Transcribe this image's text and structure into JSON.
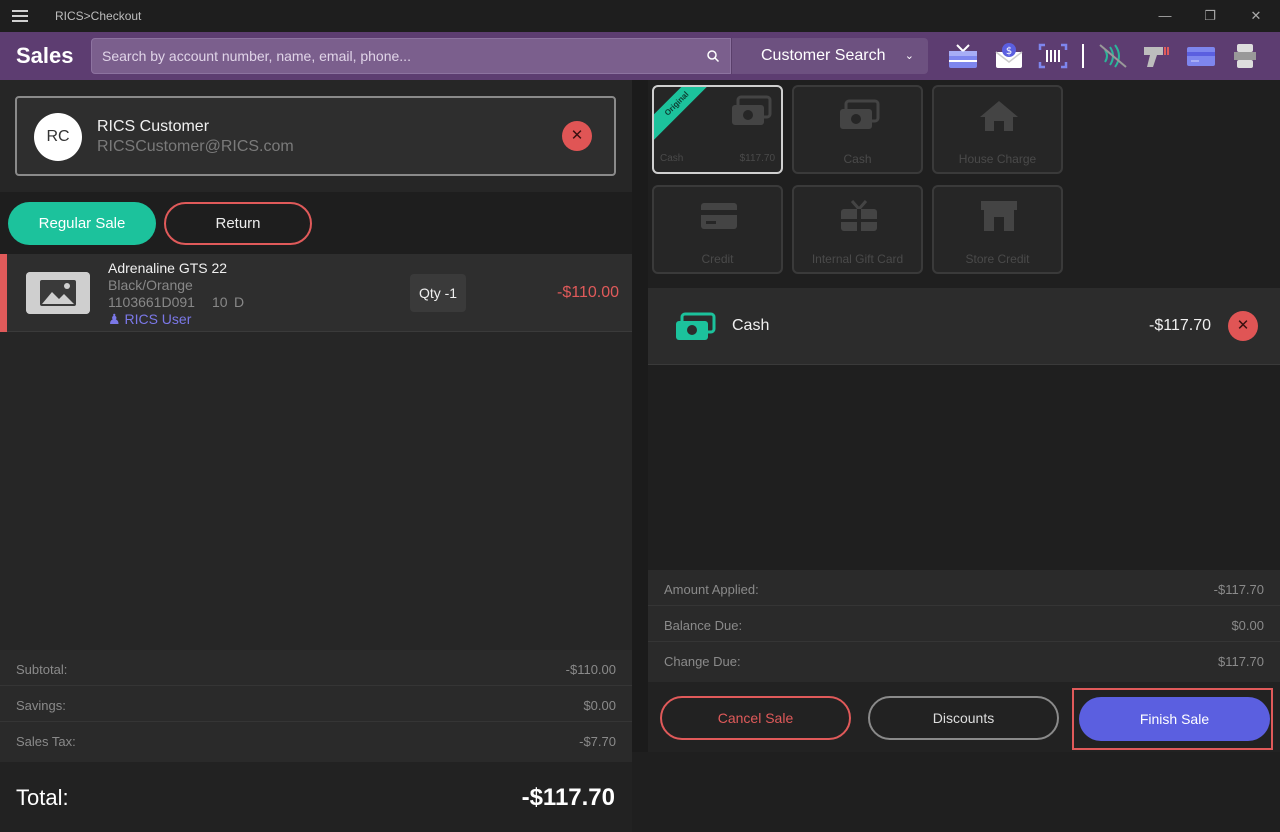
{
  "window": {
    "title": "RICS>Checkout"
  },
  "header": {
    "brand": "Sales",
    "search_placeholder": "Search by account number, name, email, phone...",
    "search_type": "Customer Search"
  },
  "customer": {
    "initials": "RC",
    "name": "RICS Customer",
    "email": "RICSCustomer@RICS.com"
  },
  "mode": {
    "regular_sale": "Regular Sale",
    "return": "Return"
  },
  "line_item": {
    "name": "Adrenaline GTS 22",
    "variant": "Black/Orange",
    "sku": "1103661D091",
    "size": "10",
    "width": "D",
    "user": "RICS User",
    "qty": "Qty -1",
    "price": "-$110.00"
  },
  "left_summary": [
    {
      "label": "Subtotal:",
      "value": "-$110.00"
    },
    {
      "label": "Savings:",
      "value": "$0.00"
    },
    {
      "label": "Sales Tax:",
      "value": "-$7.70"
    }
  ],
  "total": {
    "label": "Total:",
    "value": "-$117.70"
  },
  "tenders": {
    "original": {
      "badge": "Original",
      "label": "Cash",
      "amount": "$117.70"
    },
    "cash": "Cash",
    "house_charge": "House Charge",
    "credit": "Credit",
    "gift_card": "Internal Gift Card",
    "store_credit": "Store Credit"
  },
  "payment": {
    "label": "Cash",
    "amount": "-$117.70"
  },
  "right_summary": [
    {
      "label": "Amount Applied:",
      "value": "-$117.70"
    },
    {
      "label": "Balance Due:",
      "value": "$0.00"
    },
    {
      "label": "Change Due:",
      "value": "$117.70"
    }
  ],
  "actions": {
    "cancel": "Cancel Sale",
    "discounts": "Discounts",
    "finish": "Finish Sale"
  },
  "colors": {
    "accent_green": "#1cc29c",
    "accent_red": "#e05a5a",
    "accent_purple": "#5d3d71",
    "accent_blue": "#5b5fe0"
  }
}
